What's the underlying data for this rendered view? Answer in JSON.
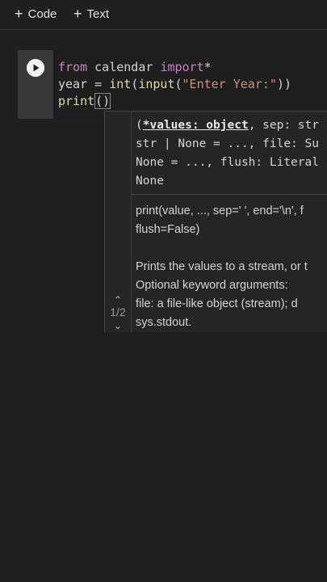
{
  "toolbar": {
    "add_code_label": "Code",
    "add_text_label": "Text"
  },
  "cell": {
    "code_lines": [
      [
        {
          "t": "from",
          "c": "kw"
        },
        {
          "t": " calendar ",
          "c": "plain"
        },
        {
          "t": "import",
          "c": "kw"
        },
        {
          "t": "*",
          "c": "plain"
        }
      ],
      [
        {
          "t": "year = ",
          "c": "plain"
        },
        {
          "t": "int",
          "c": "fn"
        },
        {
          "t": "(",
          "c": "plain"
        },
        {
          "t": "input",
          "c": "fn"
        },
        {
          "t": "(",
          "c": "plain"
        },
        {
          "t": "\"Enter Year:\"",
          "c": "str"
        },
        {
          "t": "))",
          "c": "plain"
        }
      ],
      [
        {
          "t": "print",
          "c": "fn"
        },
        {
          "t": "()",
          "c": "plain",
          "box": true
        }
      ]
    ]
  },
  "signature_help": {
    "page": "1/2",
    "signature_lines": [
      [
        {
          "t": "(",
          "c": "plain"
        },
        {
          "t": "*values: object",
          "c": "hl"
        },
        {
          "t": ", sep: str",
          "c": "plain"
        }
      ],
      [
        {
          "t": "str | None = ..., file: Su",
          "c": "plain"
        }
      ],
      [
        {
          "t": "None = ..., flush: Literal",
          "c": "plain"
        }
      ],
      [
        {
          "t": "None",
          "c": "plain"
        }
      ]
    ],
    "doc_lines": [
      "print(value, ..., sep=' ', end='\\n', f",
      "flush=False)",
      "",
      "Prints the values to a stream, or t",
      "Optional keyword arguments:",
      "file:  a file-like object (stream); d",
      "sys.stdout."
    ]
  }
}
